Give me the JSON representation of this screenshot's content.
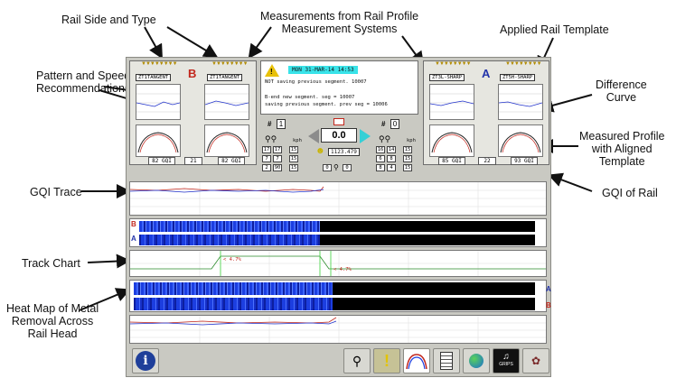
{
  "annotations": {
    "rail_side_type": "Rail Side and Type",
    "measurements_line1": "Measurements from Rail Profile",
    "measurements_line2": "Measurement Systems",
    "applied_template": "Applied Rail Template",
    "pattern_speed_line1": "Pattern and Speed",
    "pattern_speed_line2": "Recommendations",
    "difference_line1": "Difference",
    "difference_line2": "Curve",
    "measured_line1": "Measured Profile",
    "measured_line2": "with Aligned",
    "measured_line3": "Template",
    "gqi_trace": "GQI Trace",
    "gqi_of_rail": "GQI of Rail",
    "track_chart": "Track Chart",
    "heatmap_line1": "Heat Map of Metal",
    "heatmap_line2": "Removal Across",
    "heatmap_line3": "Rail Head"
  },
  "left_rail": {
    "side": "B",
    "template_left": "ZT1TANGENT",
    "template_right": "ZT1TANGENT",
    "gqi_left": "82 GQI",
    "gqi_mid": "21",
    "gqi_right": "82 GQI",
    "pattern_number": "1",
    "speed_unit": "kph",
    "rows": [
      [
        "17",
        "17",
        "15"
      ],
      [
        "7",
        "7",
        "15"
      ],
      [
        "2",
        "90",
        "15"
      ]
    ]
  },
  "right_rail": {
    "side": "A",
    "template_left": "ZT3L-SHARP",
    "template_right": "ZT5H-SHARP",
    "gqi_left": "85 GQI",
    "gqi_mid": "22",
    "gqi_right": "93 GQI",
    "pattern_number": "0",
    "speed_unit": "kph",
    "rows": [
      [
        "16",
        "14",
        "15"
      ],
      [
        "6",
        "8",
        "15"
      ],
      [
        "8",
        "4",
        "15"
      ]
    ]
  },
  "messages": {
    "date": "MON 31-MAR-14 14:53",
    "line1": "NOT saving previous segment. 10007",
    "line2": "B-end new segment. seg = 10007",
    "line3": "saving previous segment. prev seg = 10006"
  },
  "center": {
    "speed_value": "0.0",
    "position_value": "1123.479",
    "counter_left": "0",
    "counter_right": "0"
  },
  "strips": {
    "heatmap_top_left_label": "B",
    "heatmap_top_right_label": "A",
    "heatmap_bottom_right_label_a": "A",
    "heatmap_bottom_right_label_b": "B",
    "track_chart_marker_1": "< 4.7%",
    "track_chart_marker_2": "< 4.7%"
  },
  "toolbar": {
    "icons": [
      "info-icon",
      "operator-icon",
      "alert-icon",
      "profile-icon",
      "report-icon",
      "globe-icon",
      "grinder-icon",
      "settings-icon"
    ],
    "grinder_label": "GRIPS"
  },
  "colors": {
    "heatmap_blue": "#1c3ee0",
    "panel_bg": "#c9c9c2",
    "header_cyan": "#39e3e9",
    "arrow_cyan": "#35d0d6"
  }
}
